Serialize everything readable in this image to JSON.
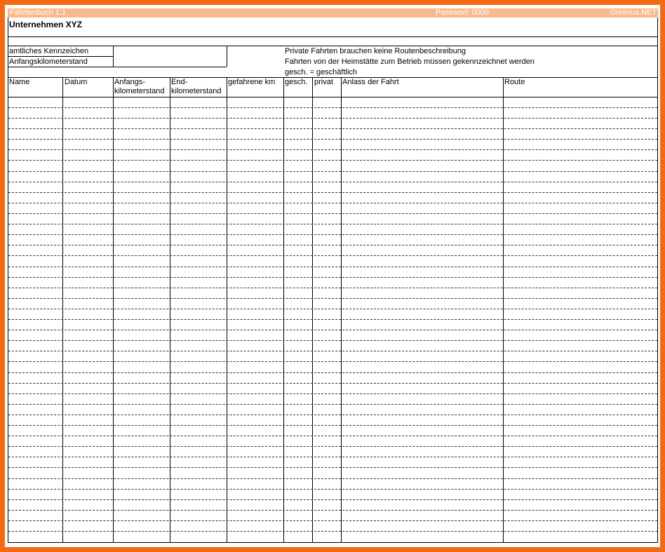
{
  "titlebar": {
    "app": "Fahrtenbuch 1.1",
    "password": "Passwort: 0000",
    "copyright": "©reimus.NET"
  },
  "company": "Unternehmen XYZ",
  "info": {
    "plate_label": "amtliches Kennzeichen",
    "start_km_label": "Anfangskilometerstand",
    "note1": "Private Fahrten brauchen keine Routenbeschreibung",
    "note2": "Fahrten von der Heimstätte zum Betrieb müssen gekennzeichnet werden",
    "note3": "gesch. = geschäftlich"
  },
  "columns": [
    {
      "line1": "",
      "line2": "Name"
    },
    {
      "line1": "",
      "line2": "Datum"
    },
    {
      "line1": "Anfangs-",
      "line2": "kilometerstand"
    },
    {
      "line1": "End-",
      "line2": "kilometerstand"
    },
    {
      "line1": "",
      "line2": "gefahrene km"
    },
    {
      "line1": "",
      "line2": "gesch."
    },
    {
      "line1": "",
      "line2": "privat"
    },
    {
      "line1": "",
      "line2": "Anlass der Fahrt"
    },
    {
      "line1": "",
      "line2": "Route"
    }
  ]
}
